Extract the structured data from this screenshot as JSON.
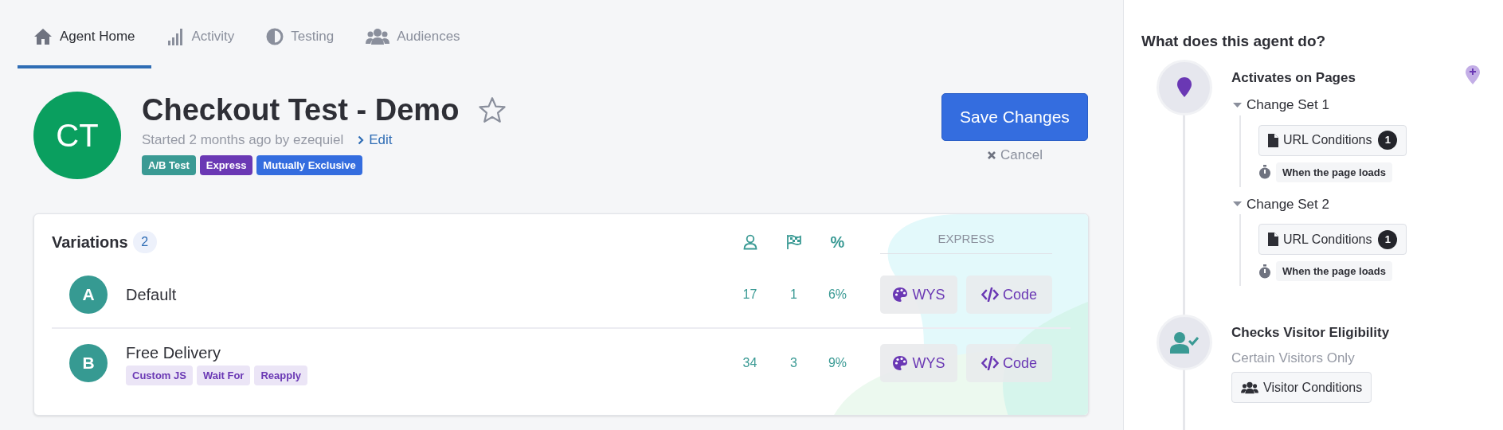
{
  "tabs": [
    {
      "label": "Agent Home",
      "kind": "home",
      "selected": true
    },
    {
      "label": "Activity",
      "kind": "activity",
      "selected": false
    },
    {
      "label": "Testing",
      "kind": "testing",
      "selected": false
    },
    {
      "label": "Audiences",
      "kind": "audiences",
      "selected": false
    }
  ],
  "agent": {
    "initials": "CT",
    "title": "Checkout Test - Demo",
    "starred": false,
    "subtitle": "Started 2 months ago by ezequiel",
    "edit_link": "Edit",
    "tags": [
      {
        "label": "A/B Test",
        "color": "#3a9a94"
      },
      {
        "label": "Express",
        "color": "#6a38b4"
      },
      {
        "label": "Mutually Exclusive",
        "color": "#346ddf"
      }
    ]
  },
  "actions": {
    "save": "Save Changes",
    "cancel": "Cancel"
  },
  "variations": {
    "title": "Variations",
    "count": "2",
    "rate_header": "%",
    "express_header": "EXPRESS",
    "rows": [
      {
        "letter": "A",
        "name": "Default",
        "visitors": "17",
        "conversions": "1",
        "rate": "6%",
        "wys": "WYS",
        "code": "Code"
      },
      {
        "letter": "B",
        "name": "Free Delivery",
        "tags": [
          "Custom JS",
          "Wait For",
          "Reapply"
        ],
        "visitors": "34",
        "conversions": "3",
        "rate": "9%",
        "wys": "WYS",
        "code": "Code"
      }
    ]
  },
  "sidebar": {
    "title": "What does this agent do?",
    "steps": [
      {
        "kind": "pages",
        "title": "Activates on Pages",
        "change_sets": [
          {
            "label": "Change Set 1",
            "expanded": true,
            "condition": "URL Conditions",
            "count": "1",
            "trigger": "When the page loads"
          },
          {
            "label": "Change Set 2",
            "expanded": true,
            "condition": "URL Conditions",
            "count": "1",
            "trigger": "When the page loads"
          }
        ]
      },
      {
        "kind": "visitors",
        "title": "Checks Visitor Eligibility",
        "subtitle": "Certain Visitors Only",
        "button": "Visitor Conditions"
      }
    ]
  }
}
